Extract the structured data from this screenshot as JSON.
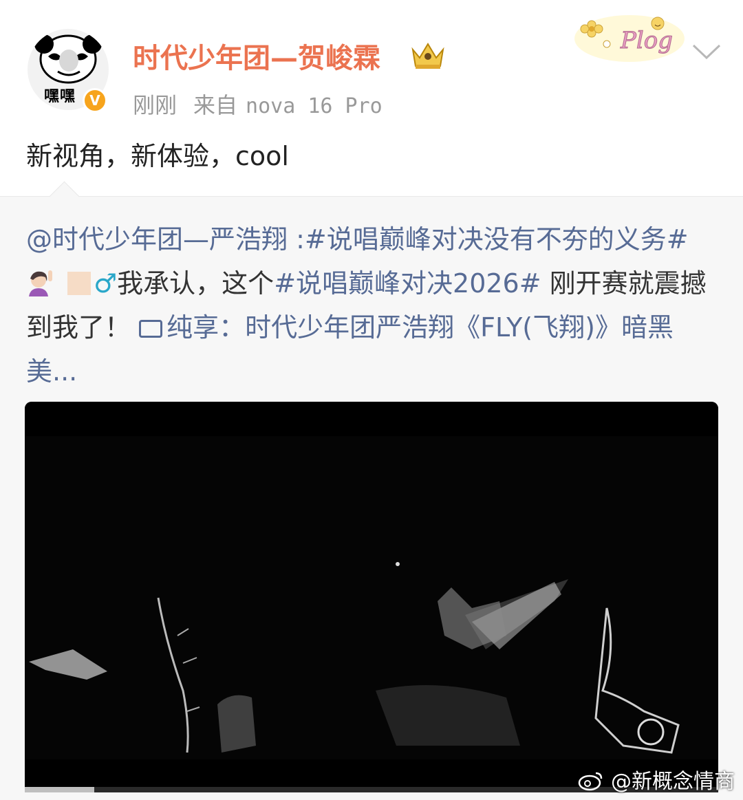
{
  "post": {
    "username": "时代少年团—贺峻霖",
    "time": "刚刚",
    "source_prefix": "来自",
    "device": "nova 16 Pro",
    "text": "新视角，新体验，cool",
    "avatar_text": "嘿嘿",
    "verified_badge": "V",
    "badge_icon": "crown-icon",
    "sticker_text": "Plog",
    "accent_color": "#eb7350"
  },
  "repost": {
    "mention": "@时代少年团—严浩翔",
    "sep": " :",
    "hashtag1": "#说唱巅峰对决没有不夯的义务#",
    "gender_symbol": "♂",
    "text1": "我承认，这个",
    "hashtag2": "#说唱巅峰对决2026#",
    "text2": "刚开赛就震撼到我了！",
    "video_link": "纯享：时代少年团严浩翔《FLY(飞翔)》暗黑美...",
    "link_color": "#576b95"
  },
  "video": {
    "progress": 0.1,
    "watermark": "@新概念情商"
  }
}
